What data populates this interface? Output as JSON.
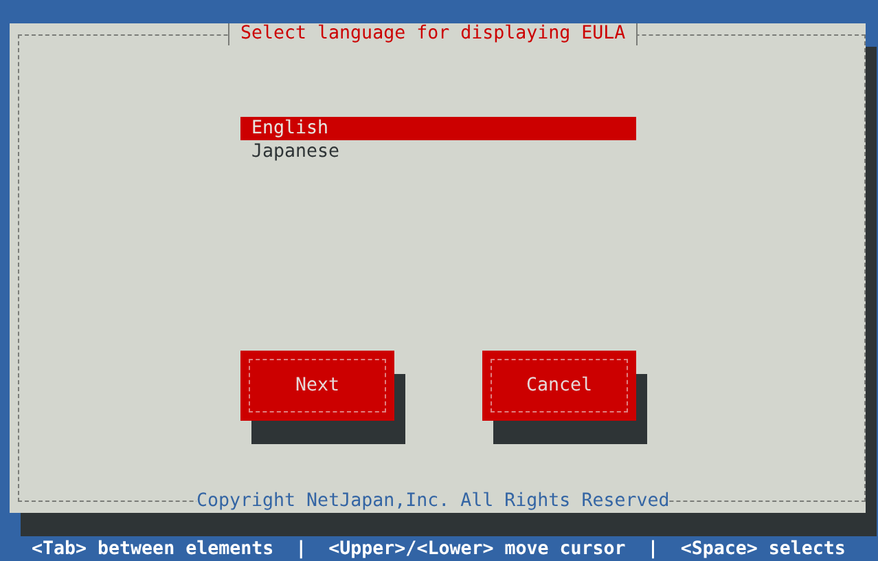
{
  "dialog": {
    "title": "Select language for displaying EULA",
    "footer": "Copyright NetJapan,Inc. All Rights Reserved",
    "languages": [
      {
        "label": "English",
        "selected": true
      },
      {
        "label": "Japanese",
        "selected": false
      }
    ],
    "buttons": [
      {
        "label": "Next"
      },
      {
        "label": "Cancel"
      }
    ]
  },
  "status_bar": "<Tab> between elements  |  <Upper>/<Lower> move cursor  |  <Space> selects"
}
